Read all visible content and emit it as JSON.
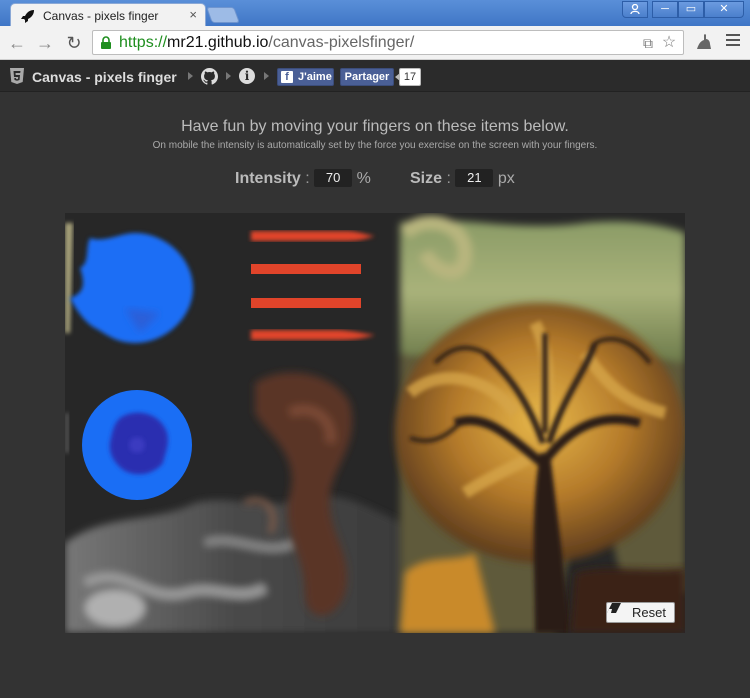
{
  "browser": {
    "tab_title": "Canvas - pixels finger",
    "tab_close": "×",
    "url_scheme": "https://",
    "url_host": "mr21.github.io",
    "url_path": "/canvas-pixelsfinger/",
    "window_buttons": {
      "minimize": "─",
      "maximize": "▭",
      "close": "✕"
    }
  },
  "sitenav": {
    "title": "Canvas - pixels finger",
    "fb_like_label": "J'aime",
    "fb_share_label": "Partager",
    "fb_count": "17"
  },
  "intro": {
    "headline": "Have fun by moving your fingers on these items below.",
    "subline": "On mobile the intensity is automatically set by the force you exercise on the screen with your fingers."
  },
  "controls": {
    "intensity_label": "Intensity",
    "intensity_value": "70",
    "intensity_unit": "%",
    "size_label": "Size",
    "size_value": "21",
    "size_unit": "px",
    "separator": ":"
  },
  "canvas": {
    "reset_label": "Reset",
    "colors": {
      "background": "#262626",
      "blue": "#1a6ef5",
      "dark_blue": "#2a2fb0",
      "red_lines": "#e0442a",
      "tree_dark": "#2b1b14",
      "tree_gold": "#d9a23a",
      "sky_green": "#9fae6e",
      "smoke_brown": "#6b3c2a"
    }
  },
  "icons": {
    "tab": "rocket-icon",
    "lock": "lock-icon",
    "site": "html5-icon",
    "github": "github-icon",
    "info": "info-icon",
    "reset": "eraser-icon"
  }
}
